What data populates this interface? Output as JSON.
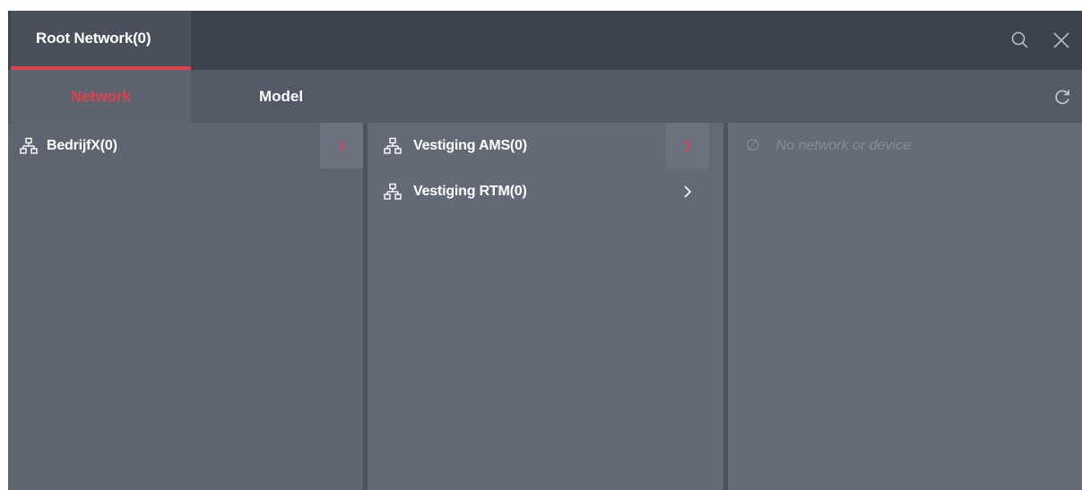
{
  "window": {
    "title": "Root Network(0)",
    "accent_color": "#e0414e"
  },
  "title_actions": {
    "search_icon": "search-icon",
    "close_icon": "close-icon"
  },
  "tabs": [
    {
      "label": "Network",
      "active": true
    },
    {
      "label": "Model",
      "active": false
    }
  ],
  "toolbar": {
    "refresh_icon": "refresh-icon"
  },
  "columns": {
    "col1": {
      "items": [
        {
          "label": "BedrijfX(0)",
          "icon": "network-icon",
          "selected": true
        }
      ]
    },
    "col2": {
      "items": [
        {
          "label": "Vestiging AMS(0)",
          "icon": "network-icon",
          "selected": true
        },
        {
          "label": "Vestiging RTM(0)",
          "icon": "network-icon",
          "selected": false
        }
      ]
    },
    "col3": {
      "empty_message": "No network or device",
      "empty_icon": "null-icon",
      "empty_symbol": "∅"
    }
  }
}
